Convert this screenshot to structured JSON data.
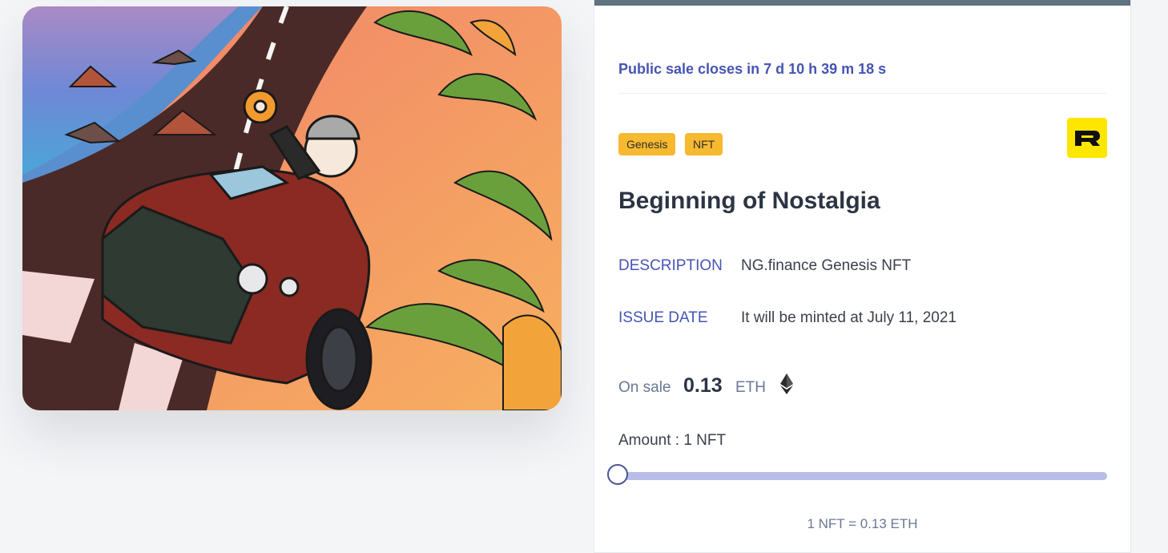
{
  "artwork": {
    "icon": "nft-artwork-convertible-car-palm-road"
  },
  "sale": {
    "countdown_text": "Public sale closes in 7 d 10 h 39 m 18 s",
    "tags": [
      "Genesis",
      "NFT"
    ],
    "brand_logo_letter": "R",
    "title": "Beginning of Nostalgia",
    "description_label": "DESCRIPTION",
    "description_value": "NG.finance Genesis NFT",
    "issue_label": "ISSUE DATE",
    "issue_value": "It will be minted at July 11, 2021",
    "on_sale_label": "On sale",
    "price": "0.13",
    "currency": "ETH",
    "currency_icon": "ethereum-icon",
    "amount_text": "Amount : 1 NFT",
    "amount_slider_fraction": 0,
    "rate_text": "1 NFT = 0.13 ETH"
  },
  "colors": {
    "accent": "#4654b3",
    "tag_bg": "#f7b92f",
    "logo_bg": "#ffe600",
    "slider_track": "#b8bde8",
    "top_bar": "#5f7380"
  }
}
